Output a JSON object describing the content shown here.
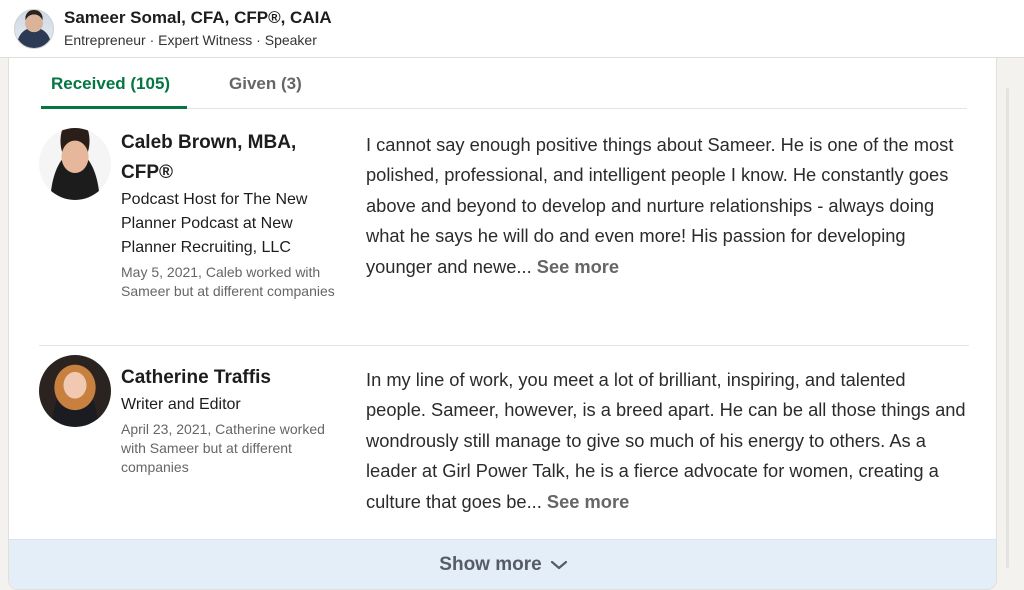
{
  "header": {
    "name": "Sameer Somal, CFA, CFP®, CAIA",
    "headline": "Entrepreneur · Expert Witness · Speaker"
  },
  "tabs": [
    {
      "label": "Received (105)",
      "active": true
    },
    {
      "label": "Given (3)",
      "active": false
    }
  ],
  "recommendations": [
    {
      "name_line1": "Caleb Brown, MBA,",
      "name_line2": "CFP®",
      "title": "Podcast Host for The New Planner Podcast at New Planner Recruiting, LLC",
      "meta": "May 5, 2021, Caleb worked with Sameer but at different companies",
      "text": "I cannot say enough positive things about Sameer. He is one of the most polished, professional, and intelligent people I know. He constantly goes above and beyond to develop and nurture relationships - always doing what he says he will do and even more! His passion for developing younger and newe...",
      "see_more": "See more"
    },
    {
      "name_line1": "Catherine Traffis",
      "title": "Writer and Editor",
      "meta": "April 23, 2021, Catherine worked with Sameer but at different companies",
      "text": "In my line of work, you meet a lot of brilliant, inspiring, and talented people. Sameer, however, is a breed apart. He can be all those things and wondrously still manage to give so much of his energy to others. As a leader at Girl Power Talk, he is a fierce advocate for women, creating a culture that goes be...",
      "see_more": "See more"
    }
  ],
  "footer": {
    "show_more": "Show more"
  },
  "colors": {
    "accent_green": "#057642",
    "show_more_bg": "#e4eef8"
  },
  "icons": {
    "show_more": "chevron-down-icon"
  }
}
